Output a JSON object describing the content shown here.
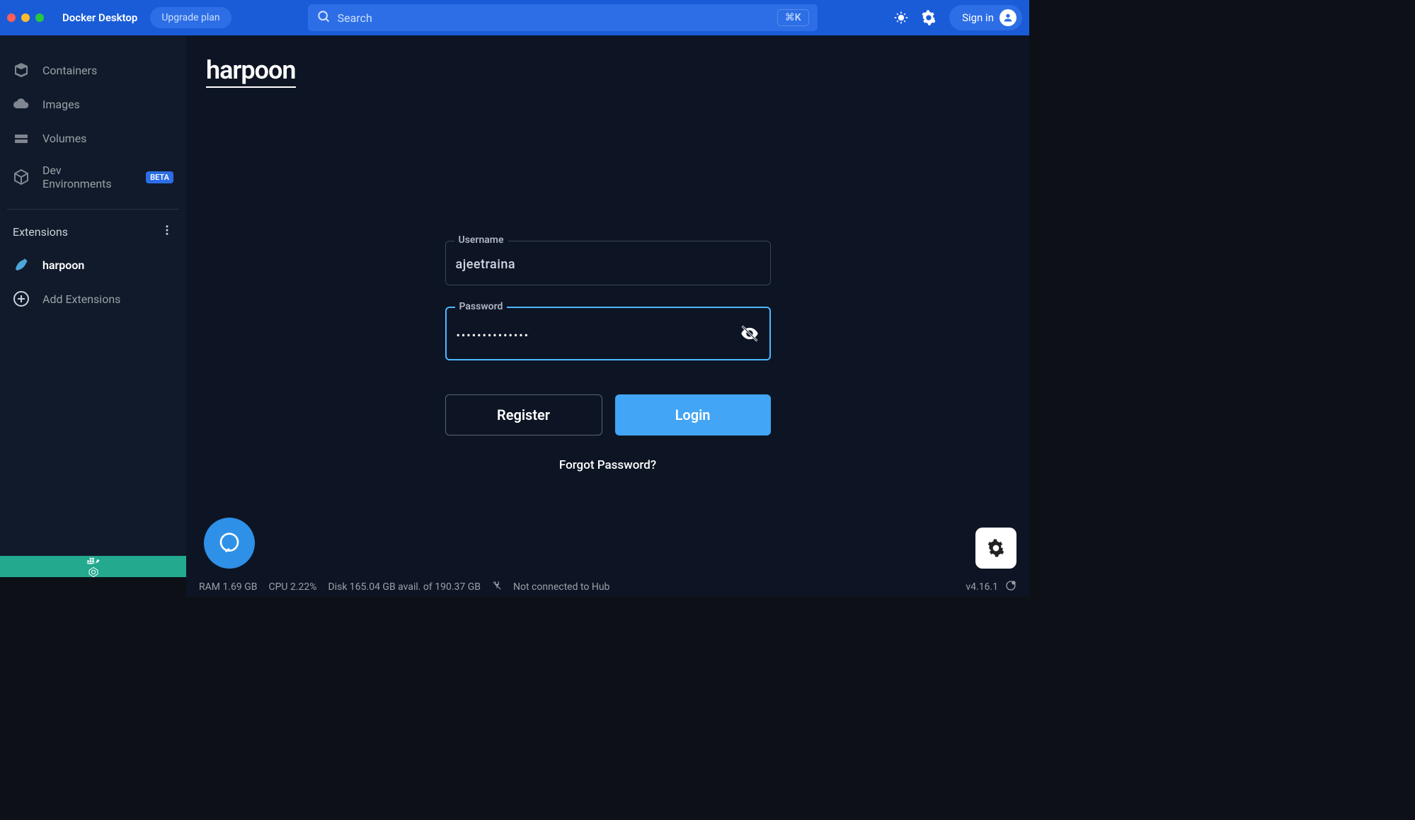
{
  "titlebar": {
    "app_name": "Docker Desktop",
    "upgrade_label": "Upgrade plan",
    "search_placeholder": "Search",
    "shortcut": "⌘K",
    "signin_label": "Sign in"
  },
  "sidebar": {
    "items": [
      {
        "label": "Containers"
      },
      {
        "label": "Images"
      },
      {
        "label": "Volumes"
      },
      {
        "label": "Dev Environments",
        "badge": "BETA"
      }
    ],
    "extensions_heading": "Extensions",
    "extensions": [
      {
        "label": "harpoon"
      }
    ],
    "add_extensions_label": "Add Extensions"
  },
  "main": {
    "logo_text": "harpoon",
    "form": {
      "username_label": "Username",
      "username_value": "ajeetraina",
      "password_label": "Password",
      "password_masked": "••••••••••••••",
      "register_label": "Register",
      "login_label": "Login",
      "forgot_label": "Forgot Password?"
    }
  },
  "statusbar": {
    "ram": "RAM 1.69 GB",
    "cpu": "CPU 2.22%",
    "disk": "Disk 165.04 GB avail. of 190.37 GB",
    "connection": "Not connected to Hub",
    "version": "v4.16.1"
  }
}
